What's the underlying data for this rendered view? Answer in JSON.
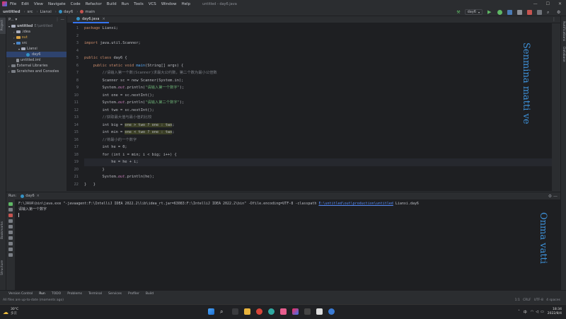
{
  "menu": {
    "items": [
      "File",
      "Edit",
      "View",
      "Navigate",
      "Code",
      "Refactor",
      "Build",
      "Run",
      "Tools",
      "VCS",
      "Window",
      "Help"
    ],
    "window_title": "untitled - day6.java"
  },
  "nav": {
    "crumbs": [
      "untitled",
      "src",
      "Lianxi",
      "day6",
      "main"
    ],
    "run_config": "day6"
  },
  "project": {
    "header": "P... ▾",
    "items": [
      {
        "label": "untitled",
        "suffix": "E:\\untitled"
      },
      {
        "label": ".idea"
      },
      {
        "label": "out"
      },
      {
        "label": "src"
      },
      {
        "label": "Lianxi"
      },
      {
        "label": "day6"
      },
      {
        "label": "untitled.iml"
      },
      {
        "label": "External Libraries"
      },
      {
        "label": "Scratches and Consoles"
      }
    ]
  },
  "editor": {
    "tab": "day6.java",
    "line_numbers": [
      "1",
      "2",
      "3",
      "4",
      "5",
      "6",
      "7",
      "8",
      "9",
      "10",
      "11",
      "12",
      "13",
      "14",
      "15",
      "16",
      "17",
      "18",
      "19",
      "20",
      "21",
      "22"
    ]
  },
  "code": {
    "l1a": "package",
    "l1b": " Lianxi;",
    "l3a": "import",
    "l3b": " java.util.Scanner;",
    "l5a": "public class",
    "l5b": " day6 {",
    "l6a": "    public static void",
    "l6b": " main",
    "l6c": "(String[] args) {",
    "l7": "        //请输入第一个数(Scanner)求最大公约数，第二个数为最小公倍数",
    "l8": "        Scanner sc = new Scanner(System.in);",
    "l9a": "        System.",
    "l9b": "out",
    "l9c": ".println(",
    "l9d": "\"请输入第一个数字\"",
    "l9e": ");",
    "l10": "        int one = sc.nextInt();",
    "l11a": "        System.",
    "l11b": "out",
    "l11c": ".println(",
    "l11d": "\"请输入第二个数字\"",
    "l11e": ");",
    "l12": "        int two = sc.nextInt();",
    "l13": "        //获取最大值与最小值的比较",
    "l14a": "        int big = ",
    "l14b": "one > two ? one : two",
    "l14c": ";",
    "l15a": "        int min = ",
    "l15b": "one < two ? one : two",
    "l15c": ";",
    "l16": "        //将最小的一个数字",
    "l17": "        int he = 0;",
    "l18": "        for (int i = min; i < big; i++) {",
    "l19": "            he = he + i;",
    "l20": "        }",
    "l21a": "        System.",
    "l21b": "out",
    "l21c": ".println(he);",
    "l22": "    }",
    "l23": "}"
  },
  "run": {
    "label": "Run:",
    "tab": "day6",
    "command_prefix": "F:\\JAVA\\bin\\java.exe \"-javaagent:F:\\IntelliJ IDEA 2022.2\\lib\\idea_rt.jar=63083:F:\\IntelliJ IDEA 2022.2\\bin\" -Dfile.encoding=UTF-8 -classpath ",
    "command_link": "E:\\untitled\\out\\production\\untitled",
    "command_suffix": " Lianxi.day6",
    "prompt": "请输入第一个数字"
  },
  "toolwindows": [
    "Version Control",
    "Run",
    "TODO",
    "Problems",
    "Terminal",
    "Services",
    "Profiler",
    "Build"
  ],
  "status": {
    "message": "All files are up-to-date (moments ago)",
    "right": "1:1   CRLF   UTF-8   4 spaces"
  },
  "watermark": {
    "top": "Senmina matti ve",
    "bottom": "Onma vatti"
  },
  "taskbar": {
    "weather_temp": "30°C",
    "weather_desc": "多云",
    "time": "18:34",
    "date": "2022/8/4",
    "lang": "中"
  }
}
